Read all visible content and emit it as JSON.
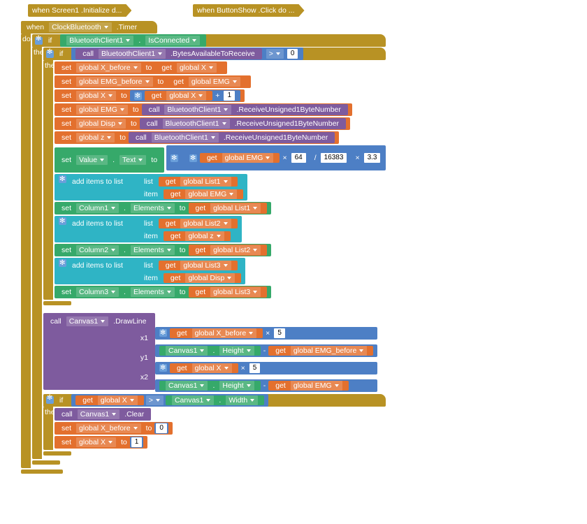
{
  "collapsed_screen1": "when  Screen1 .Initialize d...",
  "collapsed_btn": "when  ButtonShow .Click do ...",
  "when_label": "when",
  "clockbt": "ClockBluetooth",
  "timer": ".Timer",
  "do": "do",
  "if": "if",
  "then": "then",
  "btc1": "BluetoothClient1",
  "isConn": "IsConnected",
  "call": "call",
  "bytesAvail": ".BytesAvailableToReceive",
  "gt": ">",
  "zero": "0",
  "set": "set",
  "to": "to",
  "get": "get",
  "gXb": "global X_before",
  "gX": "global X",
  "gEMGb": "global EMG_before",
  "gEMG": "global EMG",
  "gDisp": "global Disp",
  "gz": "global z",
  "gL1": "global List1",
  "gL2": "global List2",
  "gL3": "global List3",
  "plus": "+",
  "one": "1",
  "recv": ".ReceiveUnsigned1ByteNumber",
  "Value": "Value",
  "Text": "Text",
  "m64": "64",
  "m16383": "16383",
  "m33": "3.3",
  "times": "×",
  "div": "/",
  "add_items": "add items to list",
  "list_slot": "list",
  "item_slot": "item",
  "Column1": "Column1",
  "Column2": "Column2",
  "Column3": "Column3",
  "Canvas1": "Canvas1",
  "Elements": "Elements",
  "DrawLine": ".DrawLine",
  "x1": "x1",
  "y1": "y1",
  "x2": "x2",
  "y2": "y2",
  "five": "5",
  "Height": "Height",
  "Width": "Width",
  "minus": "-",
  "Clear": ".Clear"
}
